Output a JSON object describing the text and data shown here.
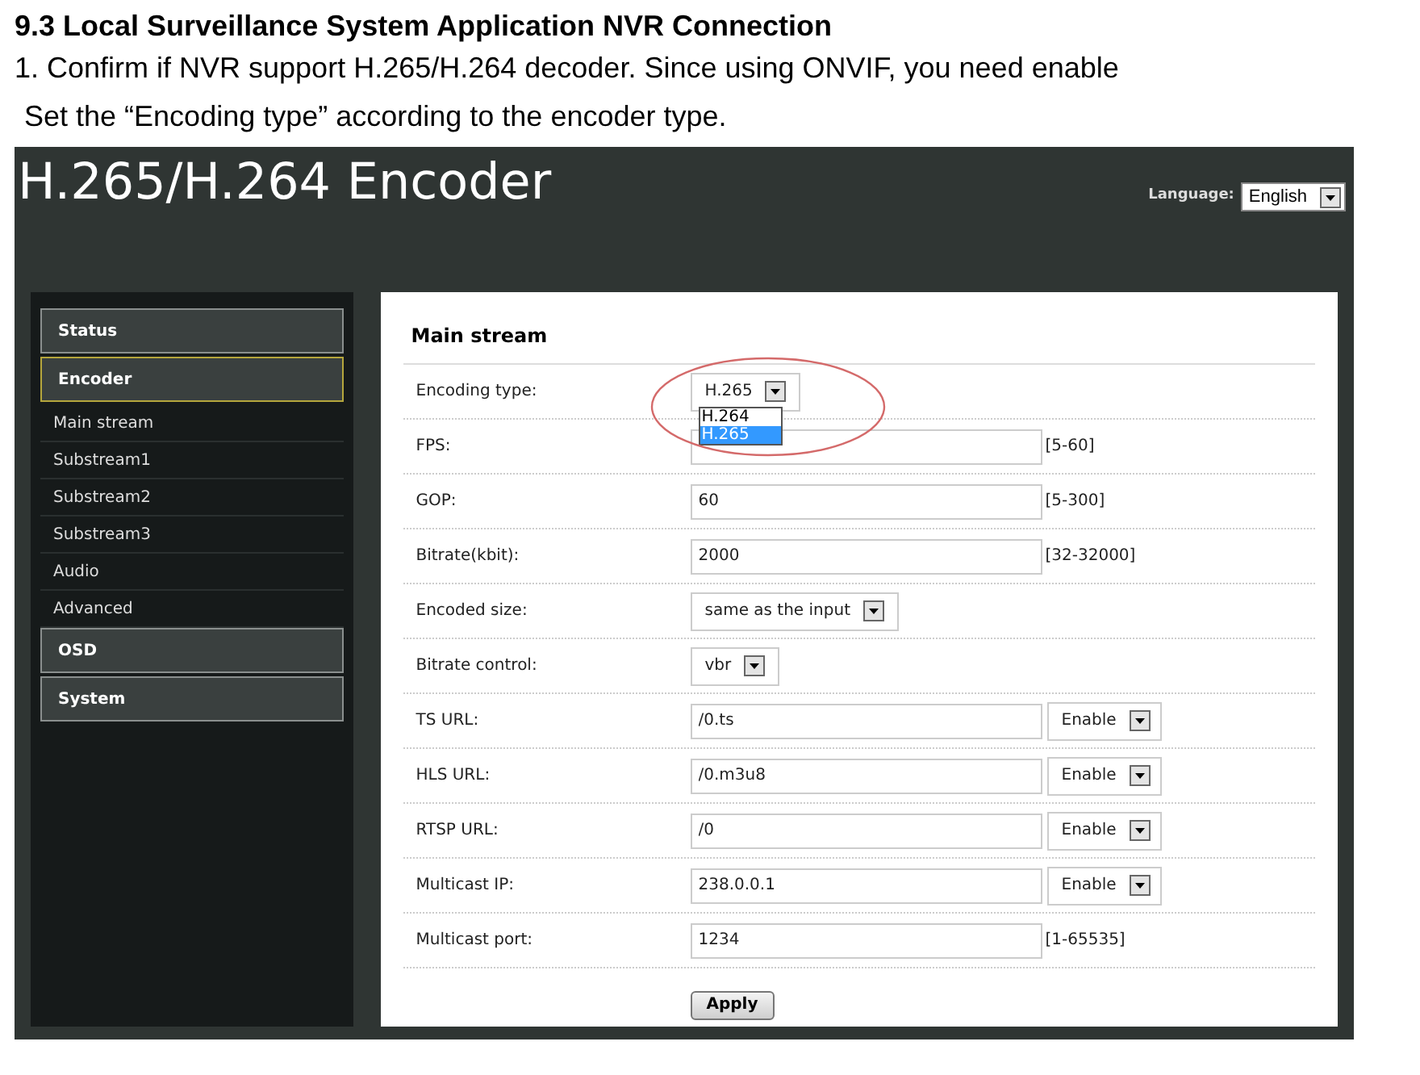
{
  "doc": {
    "heading": "9.3 Local Surveillance System Application NVR Connection",
    "lines": [
      "1. Confirm if NVR support H.265/H.264 decoder. Since using ONVIF, you need enable",
      "Set the “Encoding type” according to the encoder type."
    ]
  },
  "app": {
    "title": "H.265/H.264 Encoder",
    "language_label": "Language:",
    "language": "English",
    "sidebar": [
      {
        "kind": "header",
        "label": "Status",
        "selected": false
      },
      {
        "kind": "header",
        "label": "Encoder",
        "selected": true
      },
      {
        "kind": "subitem",
        "label": "Main stream",
        "selected": false
      },
      {
        "kind": "subitem",
        "label": "Substream1",
        "selected": false
      },
      {
        "kind": "subitem",
        "label": "Substream2",
        "selected": false
      },
      {
        "kind": "subitem",
        "label": "Substream3",
        "selected": false
      },
      {
        "kind": "subitem",
        "label": "Audio",
        "selected": false
      },
      {
        "kind": "subitem",
        "label": "Advanced",
        "selected": false
      },
      {
        "kind": "header",
        "label": "OSD",
        "selected": false
      },
      {
        "kind": "header",
        "label": "System",
        "selected": false
      }
    ],
    "section_title": "Main stream",
    "rows": [
      {
        "kind": "dropdown",
        "label": "Encoding type:",
        "value": "H.265",
        "expanded": true,
        "options": [
          {
            "label": "H.264",
            "selected": false
          },
          {
            "label": "H.265",
            "selected": true
          }
        ]
      },
      {
        "kind": "input",
        "label": "FPS:",
        "range": "[5-60]"
      },
      {
        "kind": "input",
        "label": "GOP:",
        "value": "60",
        "range": "[5-300]"
      },
      {
        "kind": "input",
        "label": "Bitrate(kbit):",
        "value": "2000",
        "range": "[32-32000]"
      },
      {
        "kind": "dropdown",
        "label": "Encoded size:",
        "value": "same as the input",
        "expanded": false
      },
      {
        "kind": "dropdown",
        "label": "Bitrate control:",
        "value": "vbr",
        "expanded": false
      },
      {
        "kind": "input",
        "label": "TS URL:",
        "value": "/0.ts",
        "toggle": "Enable"
      },
      {
        "kind": "input",
        "label": "HLS URL:",
        "value": "/0.m3u8",
        "toggle": "Enable"
      },
      {
        "kind": "input",
        "label": "RTSP URL:",
        "value": "/0",
        "toggle": "Enable"
      },
      {
        "kind": "input",
        "label": "Multicast IP:",
        "value": "238.0.0.1",
        "toggle": "Enable"
      },
      {
        "kind": "input",
        "label": "Multicast port:",
        "value": "1234",
        "range": "[1-65535]"
      }
    ],
    "apply": "Apply"
  }
}
